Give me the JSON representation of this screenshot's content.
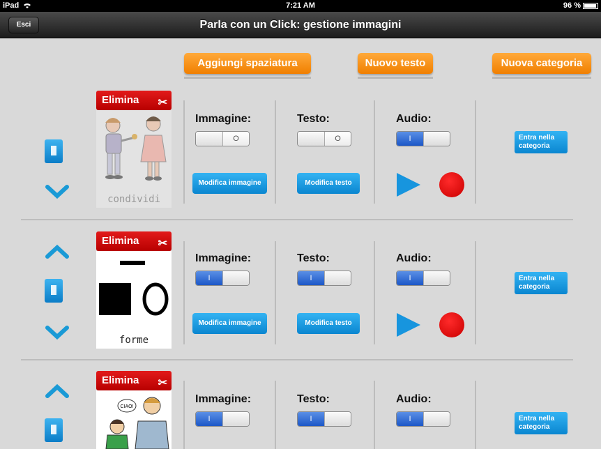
{
  "status_bar": {
    "device": "iPad",
    "time": "7:21 AM",
    "battery": "96 %"
  },
  "nav": {
    "title": "Parla con un Click: gestione immagini",
    "exit_label": "Esci"
  },
  "toolbar": {
    "add_spacing": "Aggiungi spaziatura",
    "new_text": "Nuovo testo",
    "new_category": "Nuova categoria"
  },
  "rows": [
    {
      "delete_label": "Elimina",
      "caption": "condividi",
      "image_label": "Immagine:",
      "image_toggle": "O",
      "text_label": "Testo:",
      "text_toggle": "O",
      "audio_label": "Audio:",
      "audio_toggle": "I",
      "edit_image": "Modifica immagine",
      "edit_text": "Modifica testo",
      "enter_category": "Entra nella categoria"
    },
    {
      "delete_label": "Elimina",
      "caption": "forme",
      "image_label": "Immagine:",
      "image_toggle": "I",
      "text_label": "Testo:",
      "text_toggle": "I",
      "audio_label": "Audio:",
      "audio_toggle": "I",
      "edit_image": "Modifica immagine",
      "edit_text": "Modifica testo",
      "enter_category": "Entra nella categoria"
    },
    {
      "delete_label": "Elimina",
      "image_label": "Immagine:",
      "image_toggle": "I",
      "text_label": "Testo:",
      "text_toggle": "I",
      "audio_label": "Audio:",
      "audio_toggle": "I",
      "enter_category": "Entra nella categoria",
      "speech_bubble": "CIAO!"
    }
  ],
  "colors": {
    "accent_orange": "#f07f00",
    "accent_blue": "#0a86d0",
    "delete_red": "#c90000"
  },
  "icons": {
    "move_up": "chevron-up-icon",
    "move_down": "chevron-down-icon",
    "copy": "copy-icon",
    "delete": "scissors-icon",
    "play": "play-icon",
    "record": "record-icon"
  }
}
